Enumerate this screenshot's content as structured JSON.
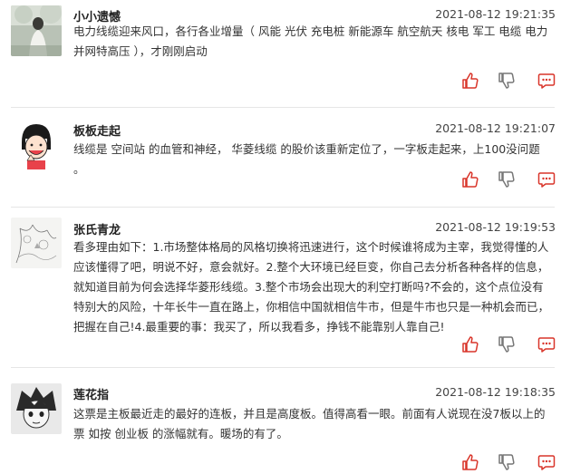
{
  "comments": [
    {
      "username": "小小遗憾",
      "time": "2021-08-12 19:21:35",
      "text": "电力线缆迎来风口，各行各业增量（ 风能 光伏 充电桩 新能源车 航空航天 核电 军工 电缆 电力并网特高压 ），才刚刚启动",
      "avatar_icon": "woman-photo-avatar"
    },
    {
      "username": "板板走起",
      "time": "2021-08-12 19:21:07",
      "text": "线缆是 空间站 的血管和神经， 华菱线缆 的股价该重新定位了，一字板走起来，上100没问题 。",
      "avatar_icon": "cartoon-girl-avatar"
    },
    {
      "username": "张氏青龙",
      "time": "2021-08-12 19:19:53",
      "text": "看多理由如下：1.市场整体格局的风格切换将迅速进行，这个时候谁将成为主宰，我觉得懂的人应该懂得了吧，明说不好，意会就好。2.整个大环境已经巨变，你自己去分析各种各样的信息，就知道目前为何会选择华菱形线缆。3.整个市场会出现大的利空打断吗?不会的，这个点位没有特别大的风险，十年长牛一直在路上，你相信中国就相信牛市，但是牛市也只是一种机会而已，把握在自己!4.最重要的事：我买了，所以我看多，挣钱不能靠别人靠自己!",
      "avatar_icon": "ink-sketch-avatar"
    },
    {
      "username": "莲花指",
      "time": "2021-08-12 19:18:35",
      "text": "这票是主板最近走的最好的连板，并且是高度板。值得高看一眼。前面有人说现在没7板以上的票 如按 创业板 的涨幅就有。暖场的有了。",
      "avatar_icon": "manga-avatar"
    }
  ],
  "action_icons": [
    "thumbs-up-icon",
    "thumbs-down-icon",
    "comment-icon"
  ],
  "accent_color": "#d9352a"
}
